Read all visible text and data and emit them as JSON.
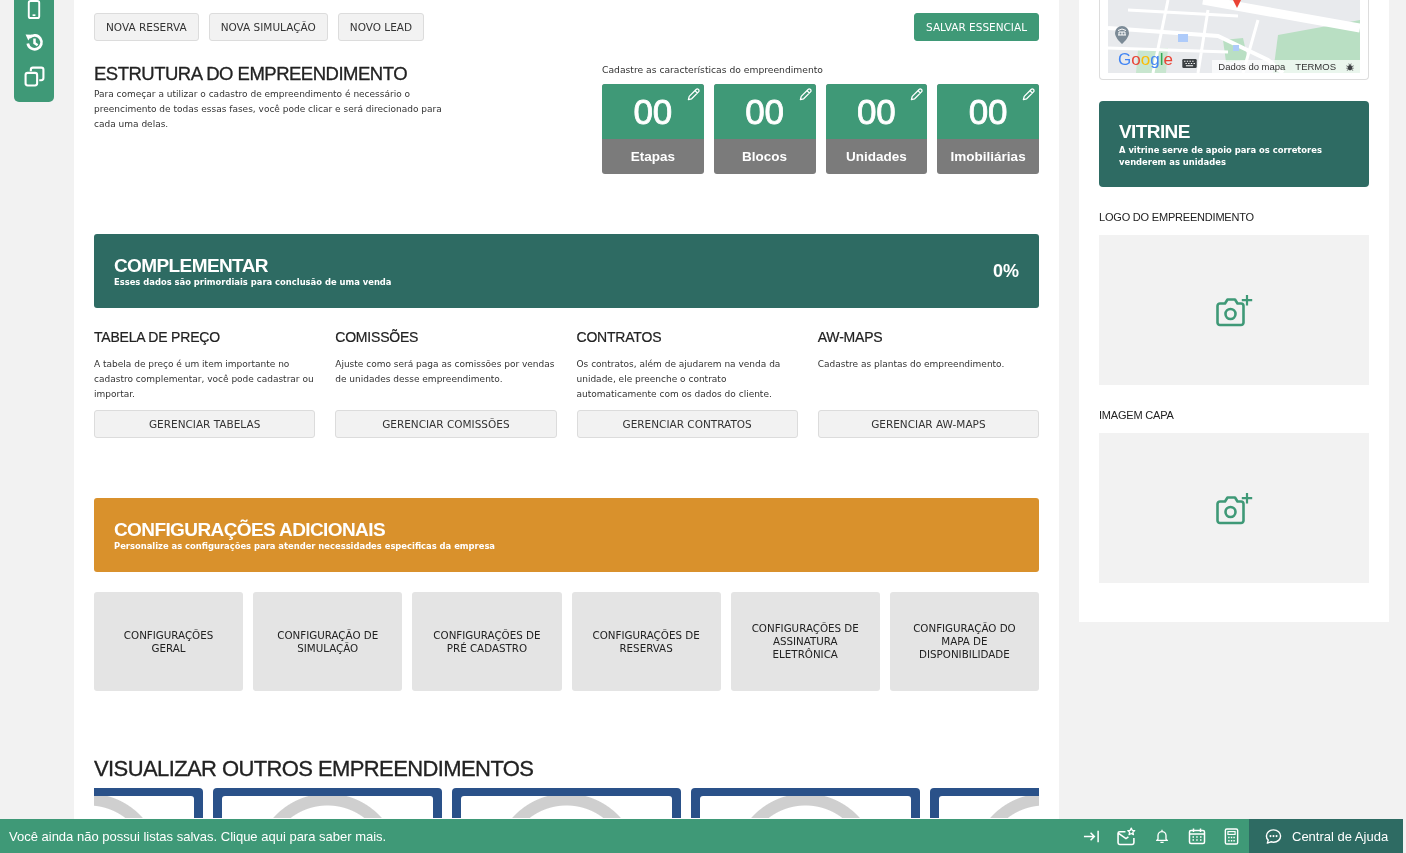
{
  "toolbar": {
    "buttons": [
      {
        "label": "NOVA RESERVA",
        "kind": "secondary"
      },
      {
        "label": "NOVA SIMULAÇÃO",
        "kind": "secondary"
      },
      {
        "label": "NOVO LEAD",
        "kind": "secondary"
      },
      {
        "label": "SALVAR ESSENCIAL",
        "kind": "primary"
      }
    ]
  },
  "structure": {
    "title": "ESTRUTURA DO EMPREENDIMENTO",
    "description": "Para começar a utilizar o cadastro de empreendimento é necessário o preencimento de todas essas fases, você pode clicar e será direcionado para cada uma delas.",
    "counters_caption": "Cadastre as características do empreendimento",
    "counters": [
      {
        "value": "00",
        "label": "Etapas"
      },
      {
        "value": "00",
        "label": "Blocos"
      },
      {
        "value": "00",
        "label": "Unidades"
      },
      {
        "value": "00",
        "label": "Imobiliárias"
      }
    ]
  },
  "complementary": {
    "title": "COMPLEMENTAR",
    "subtitle": "Esses dados são primordiais para conclusão de uma venda",
    "progress": "0%",
    "sections": [
      {
        "title": "TABELA DE PREÇO",
        "description": "A tabela de preço é um item importante no cadastro complementar, você pode cadastrar ou importar.",
        "button": "GERENCIAR TABELAS"
      },
      {
        "title": "COMISSÕES",
        "description": "Ajuste como será paga as comissões por vendas de unidades desse empreendimento.",
        "button": "GERENCIAR COMISSÕES"
      },
      {
        "title": "CONTRATOS",
        "description": "Os contratos, além de ajudarem na venda da unidade, ele preenche o contrato automaticamente com os dados do cliente.",
        "button": "GERENCIAR CONTRATOS"
      },
      {
        "title": "AW-MAPS",
        "description": "Cadastre as plantas do empreendimento.",
        "button": "GERENCIAR AW-MAPS"
      }
    ]
  },
  "additional_settings": {
    "title": "CONFIGURAÇÕES ADICIONAIS",
    "subtitle": "Personalize as configurações para atender necessidades especificas da empresa",
    "tiles": [
      "CONFIGURAÇÕES GERAL",
      "CONFIGURAÇÃO DE SIMULAÇÃO",
      "CONFIGURAÇÕES DE PRÉ CADASTRO",
      "CONFIGURAÇÕES DE RESERVAS",
      "CONFIGURAÇÕES DE ASSINATURA ELETRÔNICA",
      "CONFIGURAÇÃO DO MAPA DE DISPONIBILIDADE"
    ]
  },
  "other_developments": {
    "title": "VISUALIZAR OUTROS EMPREENDIMENTOS"
  },
  "map": {
    "logo": "Google",
    "data_link": "Dados do mapa",
    "terms_link": "TERMOS"
  },
  "showcase": {
    "title": "VITRINE",
    "subtitle": "A vitrine serve de apoio para os corretores venderem as unidades"
  },
  "uploads": [
    {
      "label": "LOGO DO EMPREENDIMENTO"
    },
    {
      "label": "IMAGEM CAPA"
    }
  ],
  "status_bar": {
    "message": "Você ainda não possui listas salvas. Clique aqui para saber mais.",
    "help_button": "Central de Ajuda"
  }
}
